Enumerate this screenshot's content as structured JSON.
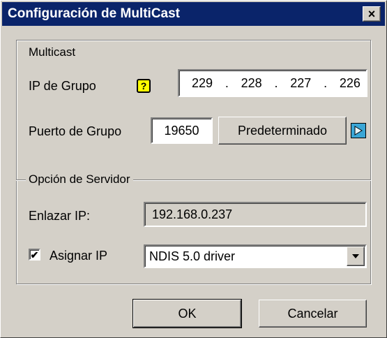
{
  "window": {
    "title": "Configuración de MultiCast",
    "close_glyph": "×",
    "close_icon": "close-icon"
  },
  "multicast": {
    "legend": "Multicast",
    "group_ip_label": "IP de Grupo",
    "help_icon": "help-question-icon",
    "help_glyph": "?",
    "group_ip": [
      "229",
      "228",
      "227",
      "226"
    ],
    "ip_separator": ".",
    "port_label": "Puerto de Grupo",
    "port_value": "19650",
    "default_button_label": "Predeterminado",
    "arrow_icon": "play-arrow-icon"
  },
  "server": {
    "legend": "Opción de Servidor",
    "bind_ip_label": "Enlazar IP:",
    "bind_ip_value": "192.168.0.237",
    "assign_ip_label": "Asignar IP",
    "assign_ip_checked": true,
    "checkbox_glyph": "✔",
    "adapter_selected": "NDIS 5.0 driver",
    "dropdown_icon": "chevron-down-icon"
  },
  "buttons": {
    "ok_label": "OK",
    "cancel_label": "Cancelar"
  },
  "colors": {
    "titlebar": "#0a246a",
    "dialog_bg": "#d4d0c8",
    "help_icon_bg": "#ffff00",
    "arrow_icon_bg": "#3aa6d6"
  }
}
